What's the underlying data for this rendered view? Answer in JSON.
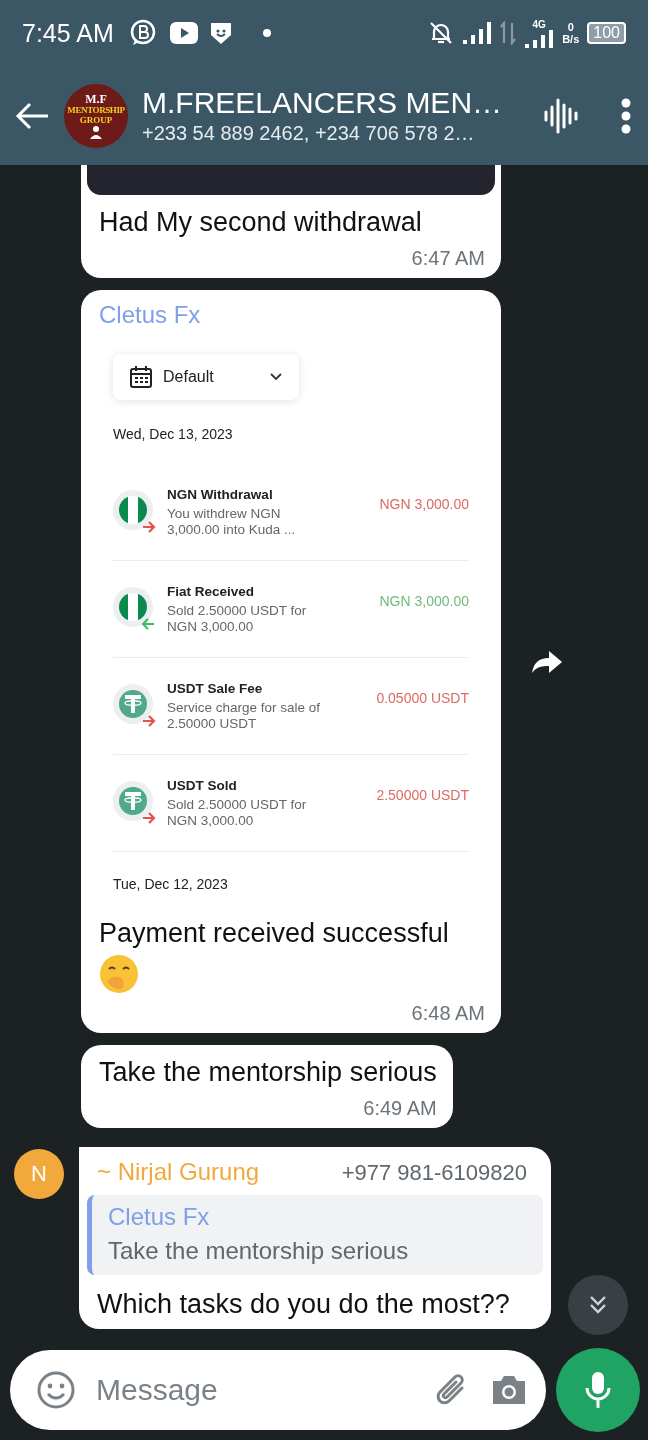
{
  "status_bar": {
    "time": "7:45 AM",
    "network": "4G",
    "speed_value": "0",
    "speed_unit": "B/s",
    "battery": "100"
  },
  "header": {
    "avatar": {
      "line_1": "M.F",
      "line_2": "MENTORSHIP",
      "line_3": "GROUP"
    },
    "title": "M.FREELANCERS MEN…",
    "subtitle": "+233 54 889 2462, +234 706 578 2…"
  },
  "messages": [
    {
      "kind": "image_text",
      "text": "Had My second withdrawal",
      "time": "6:47 AM"
    },
    {
      "kind": "screenshot",
      "sender": "Cletus Fx",
      "color": "#7f9fe6",
      "screenshot": {
        "filter": "Default",
        "date_1": "Wed, Dec 13, 2023",
        "transactions": [
          {
            "kind": "naira_out",
            "title": "NGN Withdrawal",
            "description": "You withdrew NGN 3,000.00 into Kuda ...",
            "amount": "NGN 3,000.00"
          },
          {
            "kind": "naira_in",
            "title": "Fiat Received",
            "description": "Sold 2.50000 USDT for NGN 3,000.00",
            "amount": "NGN 3,000.00"
          },
          {
            "kind": "tether_out",
            "title": "USDT Sale Fee",
            "description": "Service charge for sale of 2.50000 USDT",
            "amount": "0.05000 USDT"
          },
          {
            "kind": "tether_out",
            "title": "USDT Sold",
            "description": "Sold 2.50000 USDT for NGN 3,000.00",
            "amount": "2.50000 USDT"
          }
        ],
        "date_2": "Tue, Dec 12, 2023"
      },
      "text": "Payment received successful",
      "time": "6:48 AM"
    },
    {
      "kind": "text",
      "text": "Take the mentorship serious",
      "time": "6:49 AM"
    },
    {
      "kind": "reply",
      "avatar_letter": "N",
      "sender": "~ Nirjal Gurung",
      "color": "#f2a93b",
      "phone": "+977 981-6109820",
      "quote": {
        "sender": "Cletus Fx",
        "color": "#7f9fe6",
        "text": "Take the mentorship serious"
      },
      "text": "Which tasks do you do the most??"
    }
  ],
  "composer": {
    "placeholder": "Message"
  }
}
